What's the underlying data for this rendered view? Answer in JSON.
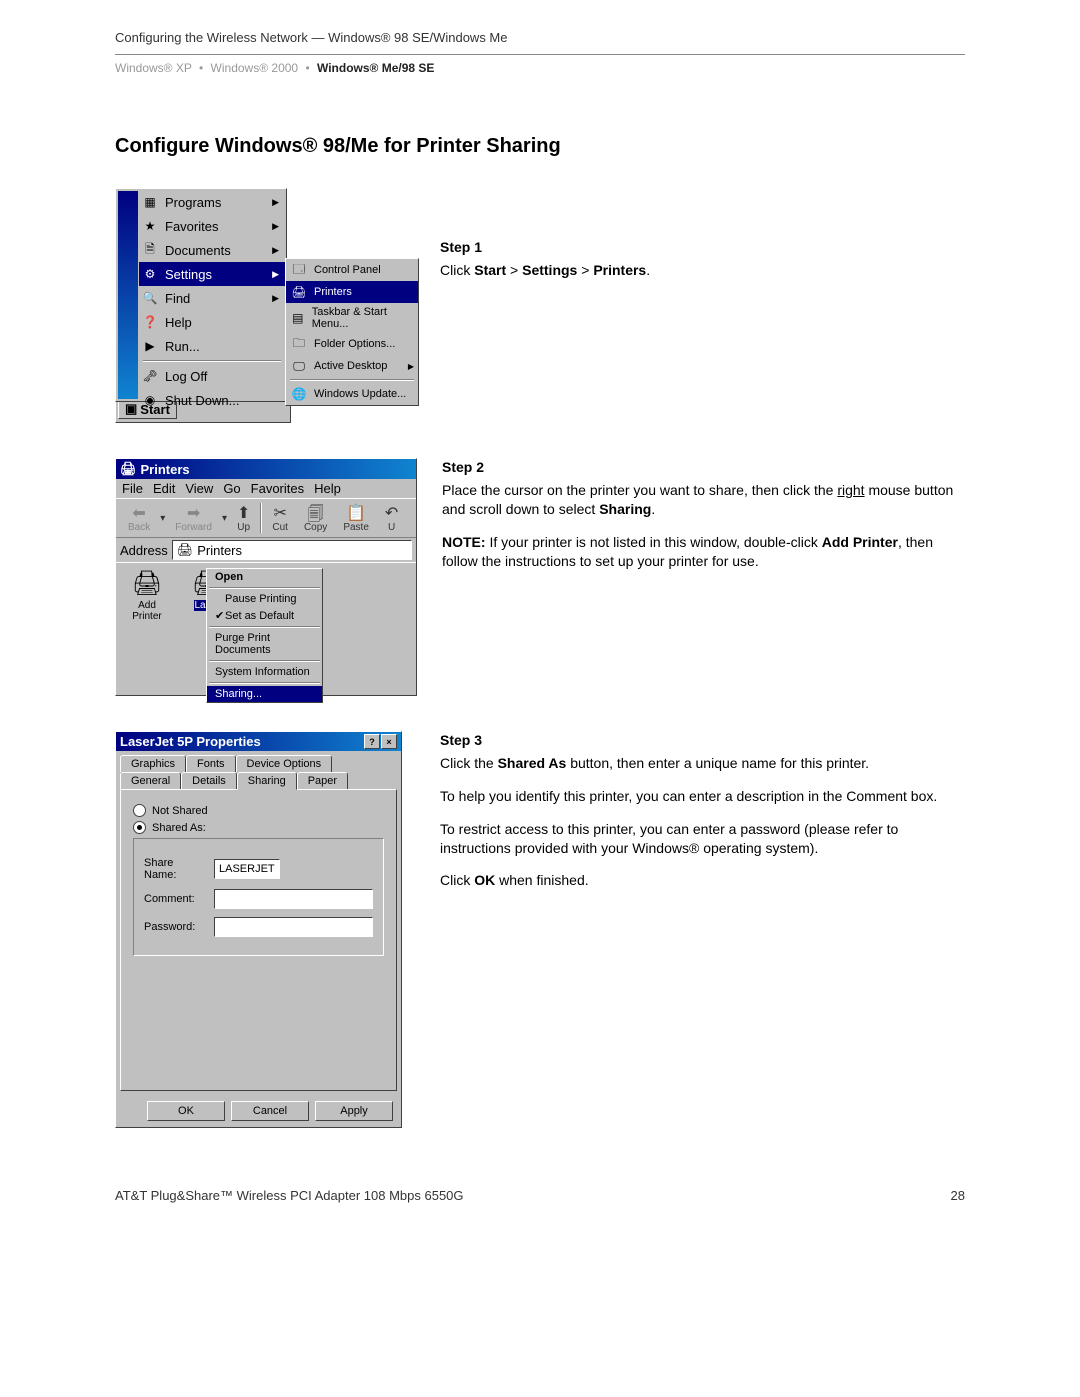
{
  "header": "Configuring the Wireless Network — Windows® 98 SE/Windows Me",
  "breadcrumb": {
    "items": [
      "Windows® XP",
      "Windows® 2000",
      "Windows® Me/98 SE"
    ],
    "activeIndex": 2
  },
  "title": "Configure Windows® 98/Me for Printer Sharing",
  "step1": {
    "title": "Step 1",
    "text": "Click Start > Settings > Printers.",
    "startMenu": {
      "items": [
        {
          "label": "Programs",
          "arrow": true,
          "icon": "▦"
        },
        {
          "label": "Favorites",
          "arrow": true,
          "icon": "★"
        },
        {
          "label": "Documents",
          "arrow": true,
          "icon": "🗎"
        },
        {
          "label": "Settings",
          "arrow": true,
          "icon": "⚙",
          "selected": true
        },
        {
          "label": "Find",
          "arrow": true,
          "icon": "🔍"
        },
        {
          "label": "Help",
          "arrow": false,
          "icon": "❓"
        },
        {
          "label": "Run...",
          "arrow": false,
          "icon": "▶"
        }
      ],
      "items2": [
        {
          "label": "Log Off",
          "icon": "🗝"
        },
        {
          "label": "Shut Down...",
          "icon": "◉"
        }
      ],
      "submenu": [
        {
          "label": "Control Panel",
          "icon": "🗔",
          "arrow": false
        },
        {
          "label": "Printers",
          "icon": "🖨",
          "arrow": false,
          "hl": true
        },
        {
          "label": "Taskbar & Start Menu...",
          "icon": "▤",
          "arrow": false
        },
        {
          "label": "Folder Options...",
          "icon": "🗀",
          "arrow": false
        },
        {
          "label": "Active Desktop",
          "icon": "🖵",
          "arrow": true
        },
        {
          "label": "Windows Update...",
          "icon": "🌐",
          "arrow": false
        }
      ],
      "startLabel": "Start"
    }
  },
  "step2": {
    "title": "Step 2",
    "para1": "Place the cursor on the printer you want to share, then click the right mouse button and scroll down to select Sharing.",
    "note_label": "NOTE:",
    "note_text": " If your printer is not listed in this window, double-click Add Printer, then follow the instructions to set up your printer for use.",
    "window": {
      "title": "Printers",
      "menus": [
        "File",
        "Edit",
        "View",
        "Go",
        "Favorites",
        "Help"
      ],
      "toolbar": [
        {
          "label": "Back",
          "icon": "⬅",
          "disabled": true
        },
        {
          "label": "Forward",
          "icon": "➡",
          "disabled": true
        },
        {
          "label": "Up",
          "icon": "⬆",
          "disabled": false
        },
        {
          "label": "Cut",
          "icon": "✂",
          "disabled": false
        },
        {
          "label": "Copy",
          "icon": "🗐",
          "disabled": false
        },
        {
          "label": "Paste",
          "icon": "📋",
          "disabled": false
        },
        {
          "label": "U",
          "icon": "↶",
          "disabled": false
        }
      ],
      "addressLabel": "Address",
      "addressValue": "Printers",
      "icons": [
        {
          "label": "Add Printer",
          "icon": "🖨"
        },
        {
          "label": "Laser",
          "icon": "🖨",
          "selected": true
        }
      ],
      "contextMenu": [
        {
          "label": "Open",
          "bold": true
        },
        {
          "sep": true
        },
        {
          "label": "Pause Printing",
          "check": ""
        },
        {
          "label": "Set as Default",
          "check": "✔"
        },
        {
          "sep": true
        },
        {
          "label": "Purge Print Documents"
        },
        {
          "sep": true
        },
        {
          "label": "System Information"
        },
        {
          "sep": true
        },
        {
          "label": "Sharing...",
          "hl": true
        }
      ]
    }
  },
  "step3": {
    "title": "Step 3",
    "para1": "Click the Shared As button, then enter a unique name for this printer.",
    "para2": "To help you identify this printer, you can enter a description in the Comment box.",
    "para3": "To restrict access to this printer, you can enter a password (please refer to instructions provided with your Windows® operating system).",
    "para4": "Click OK when finished.",
    "dialog": {
      "title": "LaserJet 5P Properties",
      "tabsTop": [
        "Graphics",
        "Fonts",
        "Device Options"
      ],
      "tabsBottom": [
        "General",
        "Details",
        "Sharing",
        "Paper"
      ],
      "activeTab": "Sharing",
      "notShared": "Not Shared",
      "sharedAs": "Shared As:",
      "shareNameLabel": "Share Name:",
      "shareNameValue": "LASERJET",
      "commentLabel": "Comment:",
      "passwordLabel": "Password:",
      "buttons": [
        "OK",
        "Cancel",
        "Apply"
      ]
    }
  },
  "footer": {
    "left": "AT&T Plug&Share™ Wireless PCI Adapter 108 Mbps 6550G",
    "right": "28"
  }
}
